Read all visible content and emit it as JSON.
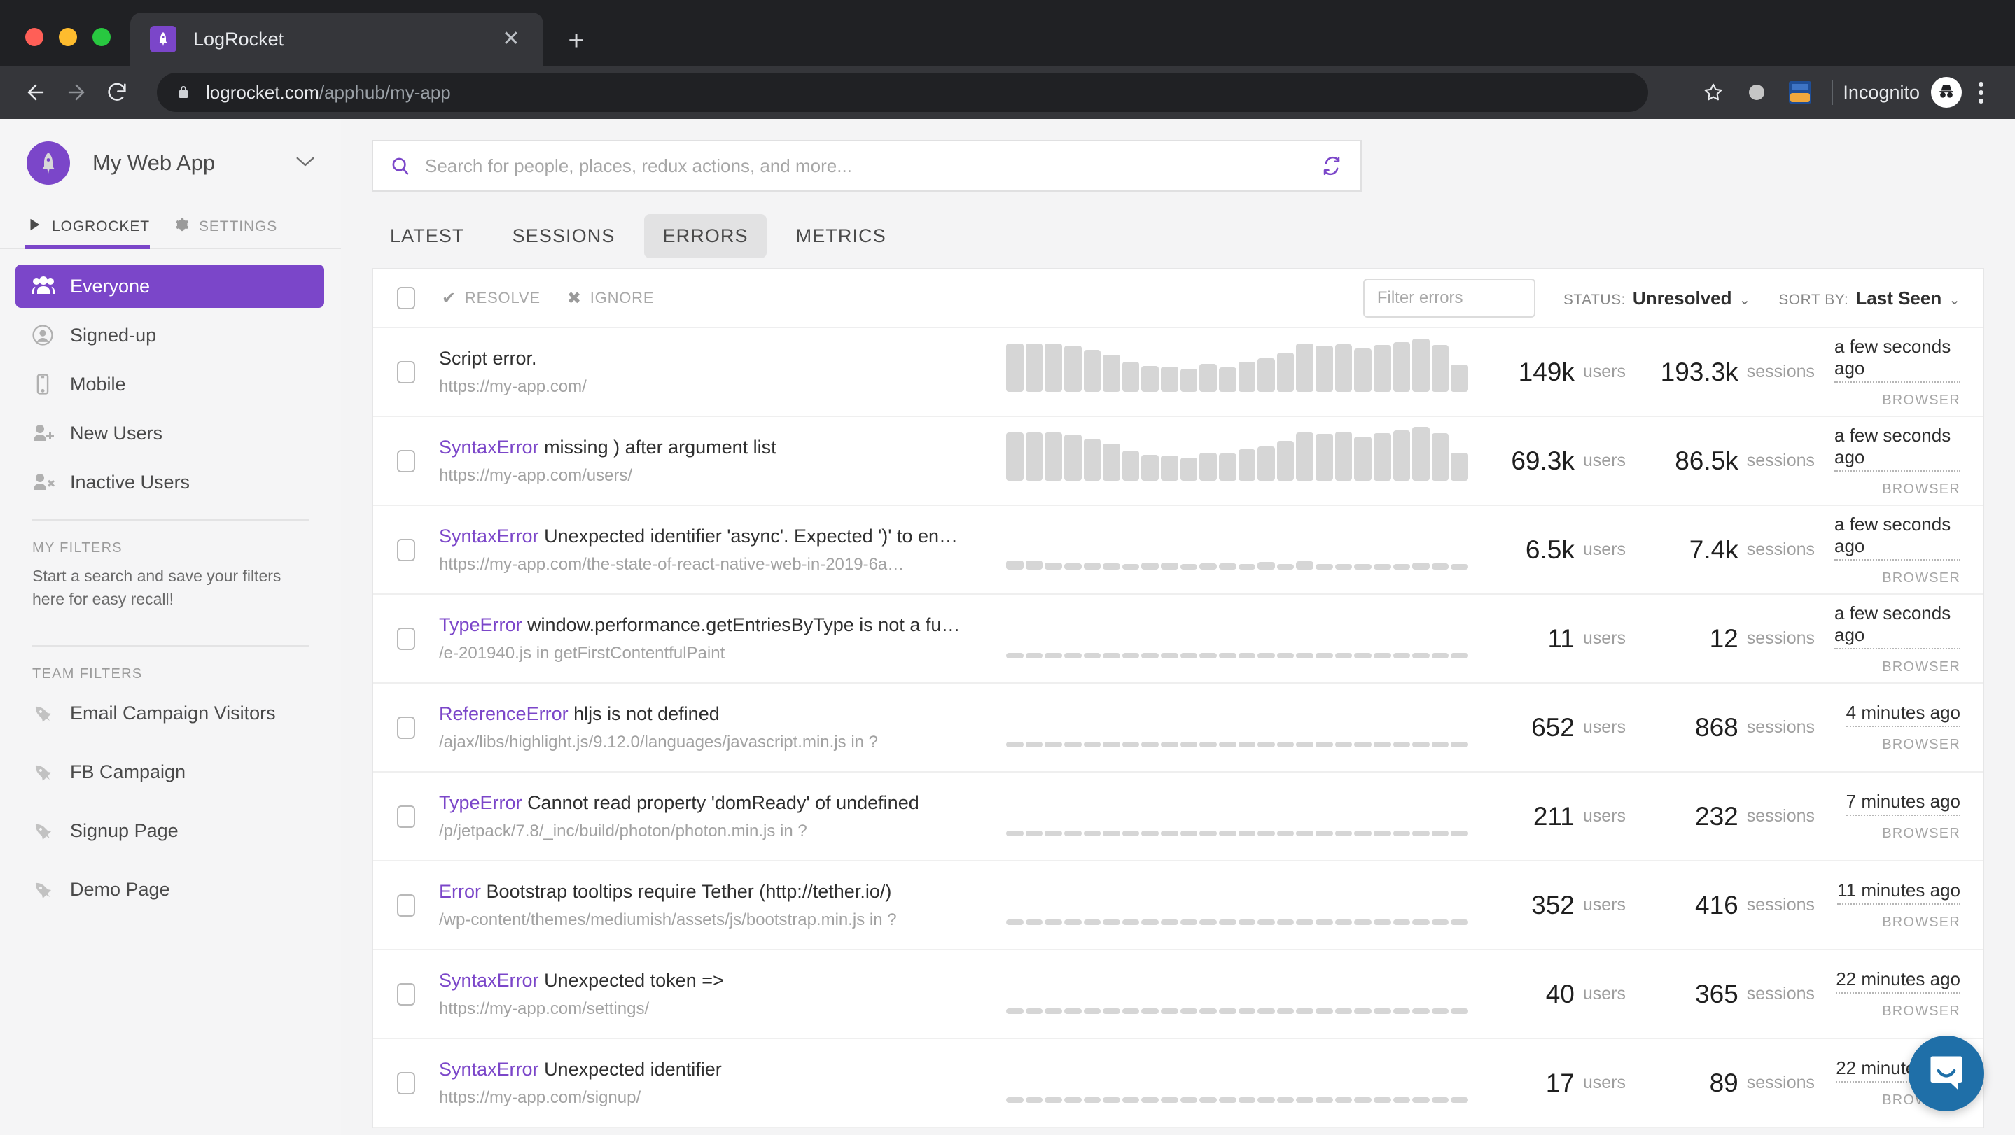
{
  "browser": {
    "tab_title": "LogRocket",
    "tab_favicon_icon": "rocket-icon",
    "close_icon": "close-icon",
    "new_tab_icon": "plus-icon",
    "back_icon": "back-arrow-icon",
    "forward_icon": "forward-arrow-icon",
    "reload_icon": "reload-icon",
    "lock_icon": "lock-icon",
    "url_host": "logrocket.com",
    "url_path": "/apphub/my-app",
    "bookmark_icon": "star-icon",
    "extension_dot_icon": "extension-dot-icon",
    "cookie_extension_icon": "cookie-inspector-icon",
    "profile_label": "Incognito",
    "profile_icon": "incognito-avatar-icon",
    "menu_icon": "kebab-menu-icon"
  },
  "sidebar": {
    "app_name": "My Web App",
    "app_avatar_icon": "rocket-avatar-icon",
    "caret_icon": "chevron-down-icon",
    "subtabs": [
      {
        "label": "LOGROCKET",
        "icon": "play-icon",
        "active": true
      },
      {
        "label": "SETTINGS",
        "icon": "gear-icon",
        "active": false
      }
    ],
    "nav_items": [
      {
        "label": "Everyone",
        "icon": "people-group-icon",
        "active": true
      },
      {
        "label": "Signed-up",
        "icon": "user-circle-icon",
        "active": false
      },
      {
        "label": "Mobile",
        "icon": "mobile-phone-icon",
        "active": false
      },
      {
        "label": "New Users",
        "icon": "user-plus-icon",
        "active": false
      },
      {
        "label": "Inactive Users",
        "icon": "user-x-icon",
        "active": false
      }
    ],
    "my_filters": {
      "label": "MY FILTERS",
      "help": "Start a search and save your filters here for easy recall!"
    },
    "team_filters": {
      "label": "TEAM FILTERS",
      "items": [
        {
          "label": "Email Campaign Visitors",
          "icon": "rocket-icon"
        },
        {
          "label": "FB Campaign",
          "icon": "rocket-icon"
        },
        {
          "label": "Signup Page",
          "icon": "rocket-icon"
        },
        {
          "label": "Demo Page",
          "icon": "rocket-icon"
        }
      ]
    }
  },
  "main": {
    "search": {
      "placeholder": "Search for people, places, redux actions, and more...",
      "value": "",
      "search_icon": "search-icon",
      "refresh_icon": "refresh-icon"
    },
    "tabs": [
      {
        "label": "LATEST",
        "active": false
      },
      {
        "label": "SESSIONS",
        "active": false
      },
      {
        "label": "ERRORS",
        "active": true
      },
      {
        "label": "METRICS",
        "active": false
      }
    ],
    "toolbar": {
      "select_all_icon": "checkbox-icon",
      "resolve_label": "RESOLVE",
      "resolve_icon": "check-icon",
      "ignore_label": "IGNORE",
      "ignore_icon": "x-icon",
      "filter_placeholder": "Filter errors",
      "filter_value": "",
      "status_key": "STATUS:",
      "status_value": "Unresolved",
      "sort_key": "SORT BY:",
      "sort_value": "Last Seen",
      "caret_icon": "chevron-down-icon"
    },
    "errors": [
      {
        "type": "",
        "message": "Script error.",
        "url": "https://my-app.com/",
        "users": "149k",
        "users_unit": "users",
        "sessions": "193.3k",
        "sessions_unit": "sessions",
        "last_seen": "a few seconds ago",
        "source": "BROWSER",
        "spark": [
          80,
          80,
          80,
          77,
          70,
          62,
          50,
          43,
          42,
          38,
          46,
          41,
          50,
          56,
          65,
          80,
          77,
          79,
          72,
          78,
          83,
          88,
          78,
          45
        ]
      },
      {
        "type": "SyntaxError",
        "message": "missing ) after argument list",
        "url": "https://my-app.com/users/",
        "users": "69.3k",
        "users_unit": "users",
        "sessions": "86.5k",
        "sessions_unit": "sessions",
        "last_seen": "a few seconds ago",
        "source": "BROWSER",
        "spark": [
          80,
          80,
          80,
          77,
          70,
          62,
          50,
          43,
          42,
          38,
          46,
          45,
          52,
          57,
          66,
          80,
          78,
          81,
          73,
          79,
          84,
          89,
          79,
          46
        ]
      },
      {
        "type": "SyntaxError",
        "message": "Unexpected identifier 'async'. Expected ')' to en…",
        "url": "https://my-app.com/the-state-of-react-native-web-in-2019-6a…",
        "users": "6.5k",
        "users_unit": "users",
        "sessions": "7.4k",
        "sessions_unit": "sessions",
        "last_seen": "a few seconds ago",
        "source": "BROWSER",
        "spark": [
          15,
          15,
          12,
          11,
          12,
          11,
          8,
          12,
          12,
          9,
          10,
          10,
          9,
          13,
          9,
          14,
          9,
          9,
          9,
          8,
          9,
          12,
          11,
          8
        ]
      },
      {
        "type": "TypeError",
        "message": "window.performance.getEntriesByType is not a fu…",
        "url": "/e-201940.js in getFirstContentfulPaint",
        "users": "11",
        "users_unit": "users",
        "sessions": "12",
        "sessions_unit": "sessions",
        "last_seen": "a few seconds ago",
        "source": "BROWSER",
        "spark": [
          5,
          5,
          5,
          5,
          5,
          5,
          5,
          5,
          5,
          5,
          5,
          5,
          5,
          5,
          5,
          5,
          5,
          5,
          5,
          5,
          5,
          5,
          5,
          5
        ]
      },
      {
        "type": "ReferenceError",
        "message": "hljs is not defined",
        "url": "/ajax/libs/highlight.js/9.12.0/languages/javascript.min.js in ?",
        "users": "652",
        "users_unit": "users",
        "sessions": "868",
        "sessions_unit": "sessions",
        "last_seen": "4 minutes ago",
        "source": "BROWSER",
        "spark": [
          5,
          5,
          5,
          5,
          5,
          5,
          5,
          5,
          5,
          5,
          5,
          5,
          5,
          5,
          5,
          5,
          5,
          5,
          5,
          5,
          5,
          5,
          5,
          5
        ]
      },
      {
        "type": "TypeError",
        "message": "Cannot read property 'domReady' of undefined",
        "url": "/p/jetpack/7.8/_inc/build/photon/photon.min.js in ?",
        "users": "211",
        "users_unit": "users",
        "sessions": "232",
        "sessions_unit": "sessions",
        "last_seen": "7 minutes ago",
        "source": "BROWSER",
        "spark": [
          5,
          5,
          5,
          5,
          5,
          5,
          5,
          5,
          5,
          5,
          5,
          5,
          5,
          5,
          5,
          5,
          5,
          5,
          5,
          5,
          5,
          5,
          5,
          5
        ]
      },
      {
        "type": "Error",
        "message": "Bootstrap tooltips require Tether (http://tether.io/)",
        "url": "/wp-content/themes/mediumish/assets/js/bootstrap.min.js in ?",
        "users": "352",
        "users_unit": "users",
        "sessions": "416",
        "sessions_unit": "sessions",
        "last_seen": "11 minutes ago",
        "source": "BROWSER",
        "spark": [
          5,
          5,
          5,
          5,
          5,
          5,
          5,
          5,
          5,
          5,
          5,
          5,
          5,
          5,
          5,
          5,
          5,
          5,
          5,
          5,
          5,
          5,
          5,
          5
        ]
      },
      {
        "type": "SyntaxError",
        "message": "Unexpected token =>",
        "url": "https://my-app.com/settings/",
        "users": "40",
        "users_unit": "users",
        "sessions": "365",
        "sessions_unit": "sessions",
        "last_seen": "22 minutes ago",
        "source": "BROWSER",
        "spark": [
          5,
          5,
          5,
          5,
          5,
          5,
          5,
          5,
          5,
          5,
          5,
          5,
          5,
          5,
          5,
          5,
          5,
          5,
          5,
          5,
          5,
          5,
          5,
          5
        ]
      },
      {
        "type": "SyntaxError",
        "message": "Unexpected identifier",
        "url": "https://my-app.com/signup/",
        "users": "17",
        "users_unit": "users",
        "sessions": "89",
        "sessions_unit": "sessions",
        "last_seen": "22 minutes ago",
        "source": "BROWSER",
        "spark": [
          5,
          5,
          5,
          5,
          5,
          5,
          5,
          5,
          5,
          5,
          5,
          5,
          5,
          5,
          5,
          5,
          5,
          5,
          5,
          5,
          5,
          5,
          5,
          5
        ]
      }
    ],
    "intercom_icon": "chat-bubble-icon"
  },
  "colors": {
    "accent_purple": "#7b46c9",
    "chrome_dark": "#35363a",
    "chrome_darker": "#202124",
    "intercom_blue": "#1f6fa8",
    "spark_gray": "#d6d6d6"
  }
}
